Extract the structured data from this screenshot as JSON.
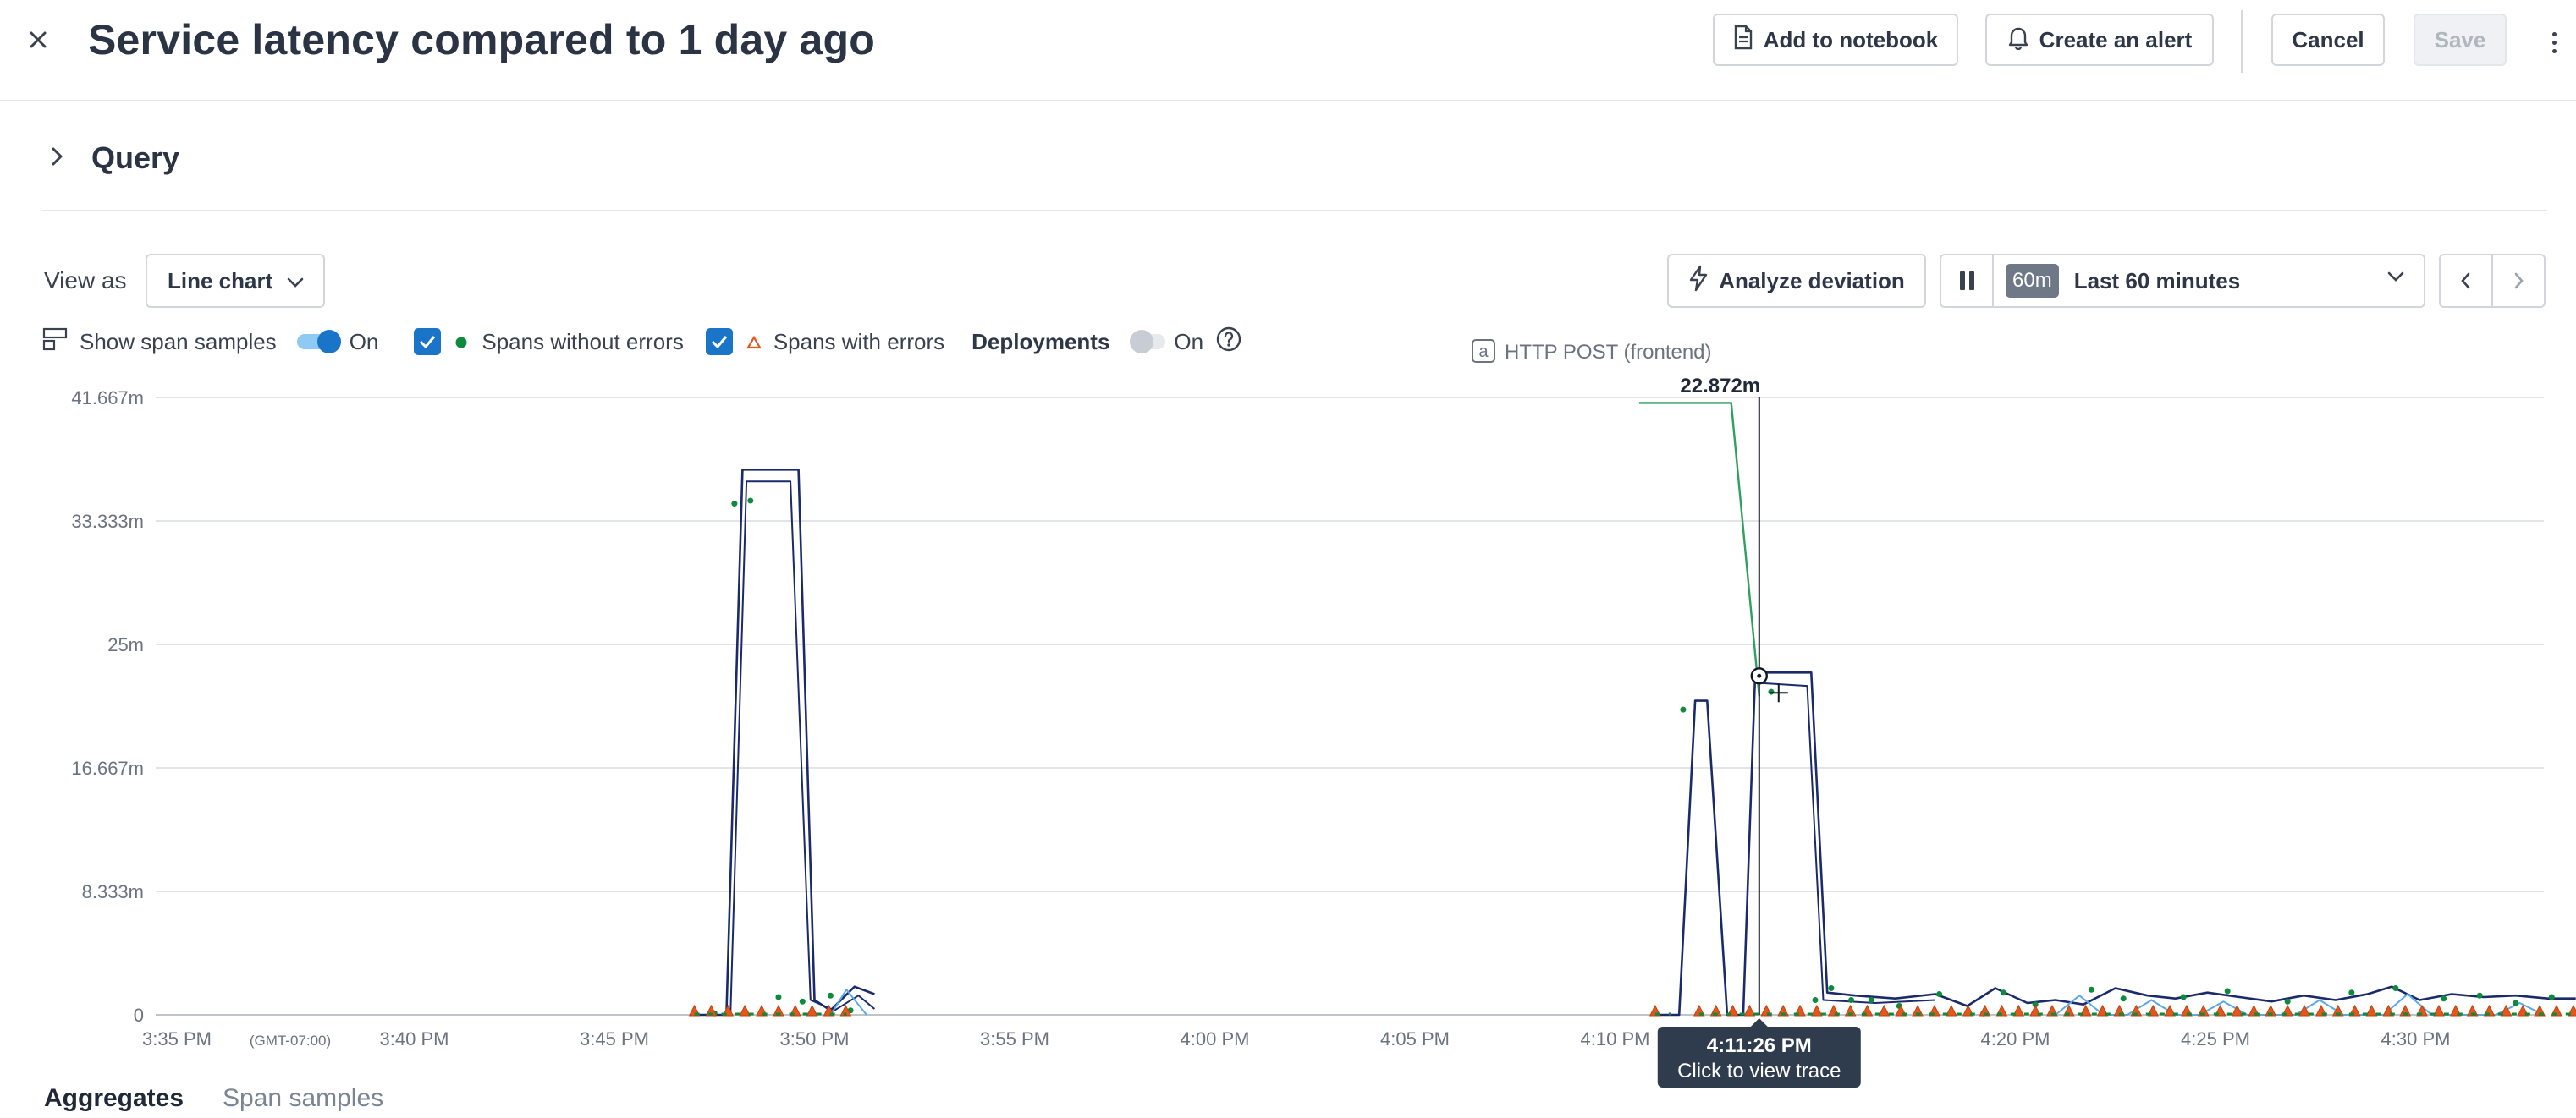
{
  "header": {
    "title": "Service latency compared to 1 day ago",
    "add_to_notebook": "Add to notebook",
    "create_alert": "Create an alert",
    "cancel": "Cancel",
    "save": "Save"
  },
  "query": {
    "label": "Query"
  },
  "toolbar": {
    "view_as_label": "View as",
    "chart_type": "Line chart",
    "analyze_deviation": "Analyze deviation",
    "time_badge": "60m",
    "time_range": "Last 60 minutes"
  },
  "legend": {
    "show_span_samples": "Show span samples",
    "span_samples_state": "On",
    "spans_without_errors": "Spans without errors",
    "spans_with_errors": "Spans with errors",
    "deployments": "Deployments",
    "deployments_state": "On"
  },
  "colors": {
    "accent": "#1a75c9",
    "series_current": "#1b2a6b",
    "series_light": "#5aa9e6",
    "series_compare": "#2ea05f",
    "ok_dot": "#0e8a3c",
    "error_marker": "#e4571c",
    "tooltip_bg": "#2f3c4d"
  },
  "chart_data": {
    "type": "line",
    "series_label": "HTTP POST (frontend)",
    "series_badge": "a",
    "y_ticks": [
      "41.667m",
      "33.333m",
      "25m",
      "16.667m",
      "8.333m",
      "0"
    ],
    "ylim": [
      0,
      41.667
    ],
    "x_ticks": [
      "3:35 PM",
      "3:40 PM",
      "3:45 PM",
      "3:50 PM",
      "3:55 PM",
      "4:00 PM",
      "4:05 PM",
      "4:10 PM",
      "4:15 PM",
      "4:20 PM",
      "4:25 PM",
      "4:30 PM"
    ],
    "x_tick_note": "(GMT-07:00)",
    "xlim_minutes": [
      0,
      59
    ],
    "series": [
      {
        "name": "current",
        "values": [
          [
            12.0,
            0
          ],
          [
            12.8,
            0
          ],
          [
            13.2,
            36.8
          ],
          [
            14.6,
            36.8
          ],
          [
            15.0,
            1.0
          ],
          [
            15.4,
            0.3
          ],
          [
            16.0,
            1.9
          ],
          [
            16.5,
            1.4
          ],
          [
            36.0,
            0
          ],
          [
            36.6,
            0
          ],
          [
            37.0,
            21.2
          ],
          [
            37.3,
            21.2
          ],
          [
            37.8,
            0
          ],
          [
            38.2,
            0
          ],
          [
            38.5,
            23.1
          ],
          [
            39.9,
            23.1
          ],
          [
            40.3,
            1.5
          ],
          [
            41.0,
            1.3
          ],
          [
            42.0,
            1.1
          ],
          [
            43.0,
            1.4
          ],
          [
            43.8,
            0.6
          ],
          [
            44.5,
            1.8
          ],
          [
            45.3,
            0.8
          ],
          [
            46.0,
            1.0
          ],
          [
            46.7,
            0.7
          ],
          [
            47.5,
            1.8
          ],
          [
            48.3,
            1.3
          ],
          [
            49.0,
            1.1
          ],
          [
            49.8,
            1.5
          ],
          [
            50.6,
            1.2
          ],
          [
            51.4,
            0.9
          ],
          [
            52.2,
            1.3
          ],
          [
            53.0,
            1.0
          ],
          [
            53.8,
            1.4
          ],
          [
            54.4,
            1.9
          ],
          [
            55.1,
            1.0
          ],
          [
            55.9,
            1.4
          ],
          [
            56.7,
            1.2
          ],
          [
            57.5,
            1.3
          ],
          [
            58.3,
            1.1
          ],
          [
            59.0,
            1.1
          ]
        ]
      },
      {
        "name": "current-lower",
        "values": [
          [
            12.0,
            0
          ],
          [
            12.9,
            0
          ],
          [
            13.3,
            36.0
          ],
          [
            14.4,
            36.0
          ],
          [
            14.9,
            1.0
          ],
          [
            15.5,
            0.3
          ],
          [
            16.1,
            1.3
          ],
          [
            16.5,
            0.4
          ],
          [
            38.6,
            22.4
          ],
          [
            39.8,
            22.2
          ],
          [
            40.2,
            1.0
          ],
          [
            41.5,
            0.8
          ],
          [
            43.0,
            1.0
          ]
        ]
      },
      {
        "name": "light",
        "values": [
          [
            15.4,
            0
          ],
          [
            15.8,
            1.7
          ],
          [
            16.3,
            0
          ],
          [
            46.0,
            0
          ],
          [
            46.6,
            1.3
          ],
          [
            47.2,
            0
          ],
          [
            47.8,
            0
          ],
          [
            48.4,
            1.0
          ],
          [
            49.0,
            0
          ],
          [
            49.6,
            0
          ],
          [
            50.2,
            0.9
          ],
          [
            50.8,
            0
          ],
          [
            52.0,
            0
          ],
          [
            52.6,
            1.0
          ],
          [
            53.2,
            0
          ],
          [
            54.2,
            0
          ],
          [
            54.8,
            1.4
          ],
          [
            55.4,
            0
          ],
          [
            57.0,
            0
          ],
          [
            57.6,
            0.8
          ],
          [
            58.2,
            0
          ]
        ]
      },
      {
        "name": "compare",
        "values": [
          [
            35.6,
            41.3
          ],
          [
            37.9,
            41.3
          ],
          [
            38.6,
            21.5
          ]
        ]
      }
    ],
    "ok_samples": [
      [
        13.0,
        34.5
      ],
      [
        13.4,
        34.7
      ],
      [
        14.1,
        1.2
      ],
      [
        14.7,
        0.9
      ],
      [
        15.4,
        1.3
      ],
      [
        15.9,
        0.3
      ],
      [
        36.7,
        20.6
      ],
      [
        38.9,
        21.8
      ],
      [
        40.0,
        1.0
      ],
      [
        40.4,
        1.8
      ],
      [
        40.9,
        1.0
      ],
      [
        41.4,
        1.0
      ],
      [
        42.1,
        0.6
      ],
      [
        43.1,
        1.4
      ],
      [
        44.7,
        1.5
      ],
      [
        45.5,
        0.7
      ],
      [
        46.9,
        1.7
      ],
      [
        47.7,
        1.1
      ],
      [
        49.2,
        1.2
      ],
      [
        50.3,
        1.6
      ],
      [
        51.8,
        0.9
      ],
      [
        53.4,
        1.5
      ],
      [
        54.5,
        1.8
      ],
      [
        55.7,
        1.1
      ],
      [
        56.6,
        1.3
      ],
      [
        57.5,
        0.8
      ],
      [
        58.4,
        1.2
      ],
      [
        12.5,
        0.1
      ],
      [
        37.5,
        0.1
      ],
      [
        44.2,
        0.1
      ]
    ],
    "error_clusters": [
      [
        12.0,
        15.8
      ],
      [
        36.0,
        36.4
      ],
      [
        37.1,
        59.0
      ]
    ],
    "cursor": {
      "x_min": 38.6,
      "value": "22.872m",
      "y_val": 22.872
    },
    "tooltip": {
      "time": "4:11:26 PM",
      "hint": "Click to view trace"
    }
  },
  "bottom_tabs": {
    "aggregates": "Aggregates",
    "span_samples": "Span samples"
  }
}
